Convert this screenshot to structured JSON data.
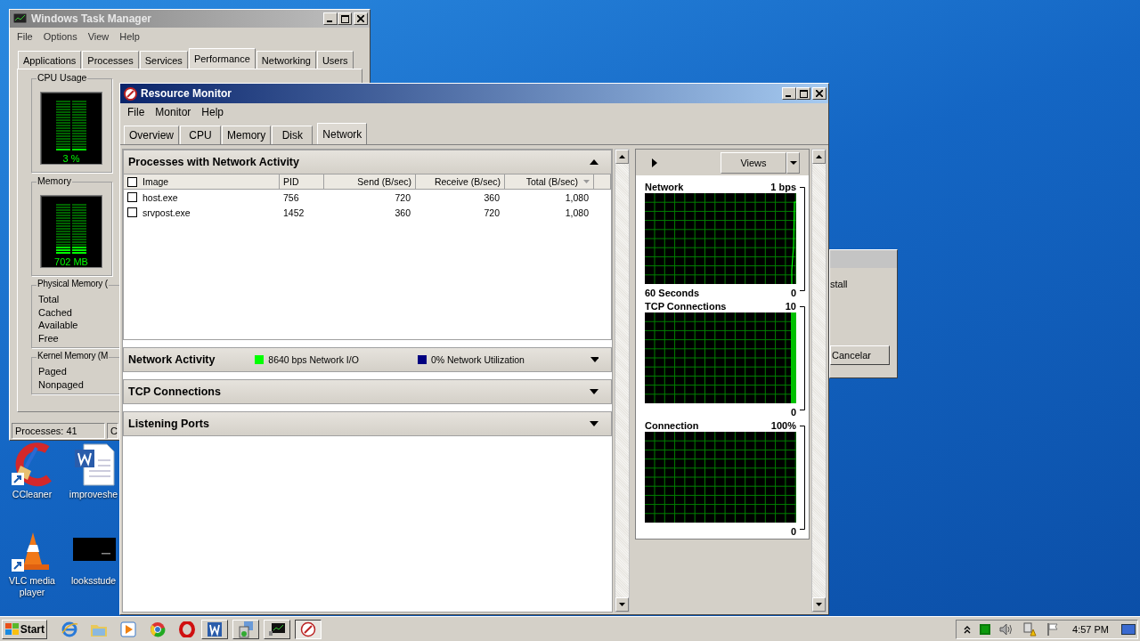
{
  "desktop_icons": [
    {
      "label": "CCleaner",
      "kind": "cleaner"
    },
    {
      "label": "improveshe",
      "kind": "document"
    },
    {
      "label": "VLC media player",
      "kind": "cone"
    },
    {
      "label": "looksstude",
      "kind": "thumbnail"
    }
  ],
  "task_manager": {
    "title": "Windows Task Manager",
    "menu": [
      "File",
      "Options",
      "View",
      "Help"
    ],
    "tabs": [
      {
        "label": "Applications",
        "selected": false
      },
      {
        "label": "Processes",
        "selected": false
      },
      {
        "label": "Services",
        "selected": false
      },
      {
        "label": "Performance",
        "selected": true
      },
      {
        "label": "Networking",
        "selected": false
      },
      {
        "label": "Users",
        "selected": false
      }
    ],
    "cpu": {
      "title": "CPU Usage",
      "reading": "3 %",
      "level": 0.03
    },
    "memory": {
      "title": "Memory",
      "reading": "702 MB",
      "level": 0.15
    },
    "physical_memory": {
      "title": "Physical Memory (",
      "rows": [
        "Total",
        "Cached",
        "Available",
        "Free"
      ]
    },
    "kernel_memory": {
      "title": "Kernel Memory (M",
      "rows": [
        "Paged",
        "Nonpaged"
      ]
    },
    "status_bar": [
      "Processes: 41",
      "C"
    ]
  },
  "dialog": {
    "text": "stall",
    "button": "Cancelar"
  },
  "resource_monitor": {
    "title": "Resource Monitor",
    "menu": [
      "File",
      "Monitor",
      "Help"
    ],
    "tabs": [
      {
        "label": "Overview",
        "selected": false
      },
      {
        "label": "CPU",
        "selected": false
      },
      {
        "label": "Memory",
        "selected": false
      },
      {
        "label": "Disk",
        "selected": false
      },
      {
        "label": "Network",
        "selected": true
      }
    ],
    "sections": [
      {
        "title": "Processes with Network Activity",
        "expanded": true,
        "table": {
          "header_checked": false,
          "columns": [
            {
              "label": "Image",
              "sorted": false
            },
            {
              "label": "PID",
              "sorted": false
            },
            {
              "label": "Send (B/sec)",
              "sorted": false
            },
            {
              "label": "Receive (B/sec)",
              "sorted": false
            },
            {
              "label": "Total (B/sec)",
              "sorted": true
            }
          ],
          "rows": [
            {
              "checked": false,
              "cells": [
                "host.exe",
                "756",
                "720",
                "360",
                "1,080"
              ]
            },
            {
              "checked": false,
              "cells": [
                "srvpost.exe",
                "1452",
                "360",
                "720",
                "1,080"
              ]
            }
          ]
        }
      },
      {
        "title": "Network Activity",
        "expanded": false,
        "indicators": [
          {
            "label": "8640 bps Network I/O",
            "color": "#00ff00"
          },
          {
            "label": "0% Network Utilization",
            "color": "#000080"
          }
        ]
      },
      {
        "title": "TCP Connections",
        "expanded": false
      },
      {
        "title": "Listening Ports",
        "expanded": false
      }
    ],
    "views_button": "Views",
    "graphs": [
      {
        "title": "Network",
        "max": "1 bps",
        "footer": "60 Seconds",
        "min": "0",
        "kind": "line"
      },
      {
        "title": "TCP Connections",
        "max": "10",
        "min": "0",
        "kind": "bar"
      },
      {
        "title": "Connection",
        "max": "100%",
        "min": "0",
        "kind": "flat"
      }
    ]
  },
  "taskbar": {
    "start": "Start",
    "apps": [
      {
        "kind": "browser",
        "framed": false,
        "selected": false
      },
      {
        "kind": "folder",
        "framed": false,
        "selected": false
      },
      {
        "kind": "player",
        "framed": false,
        "selected": false
      },
      {
        "kind": "globe",
        "framed": false,
        "selected": false
      },
      {
        "kind": "ring",
        "framed": false,
        "selected": false
      },
      {
        "kind": "document",
        "framed": true,
        "selected": false
      },
      {
        "kind": "installer",
        "framed": true,
        "selected": false
      },
      {
        "kind": "monitor",
        "framed": true,
        "selected": false
      },
      {
        "kind": "gauge",
        "framed": true,
        "selected": true
      }
    ],
    "clock": "4:57 PM"
  }
}
